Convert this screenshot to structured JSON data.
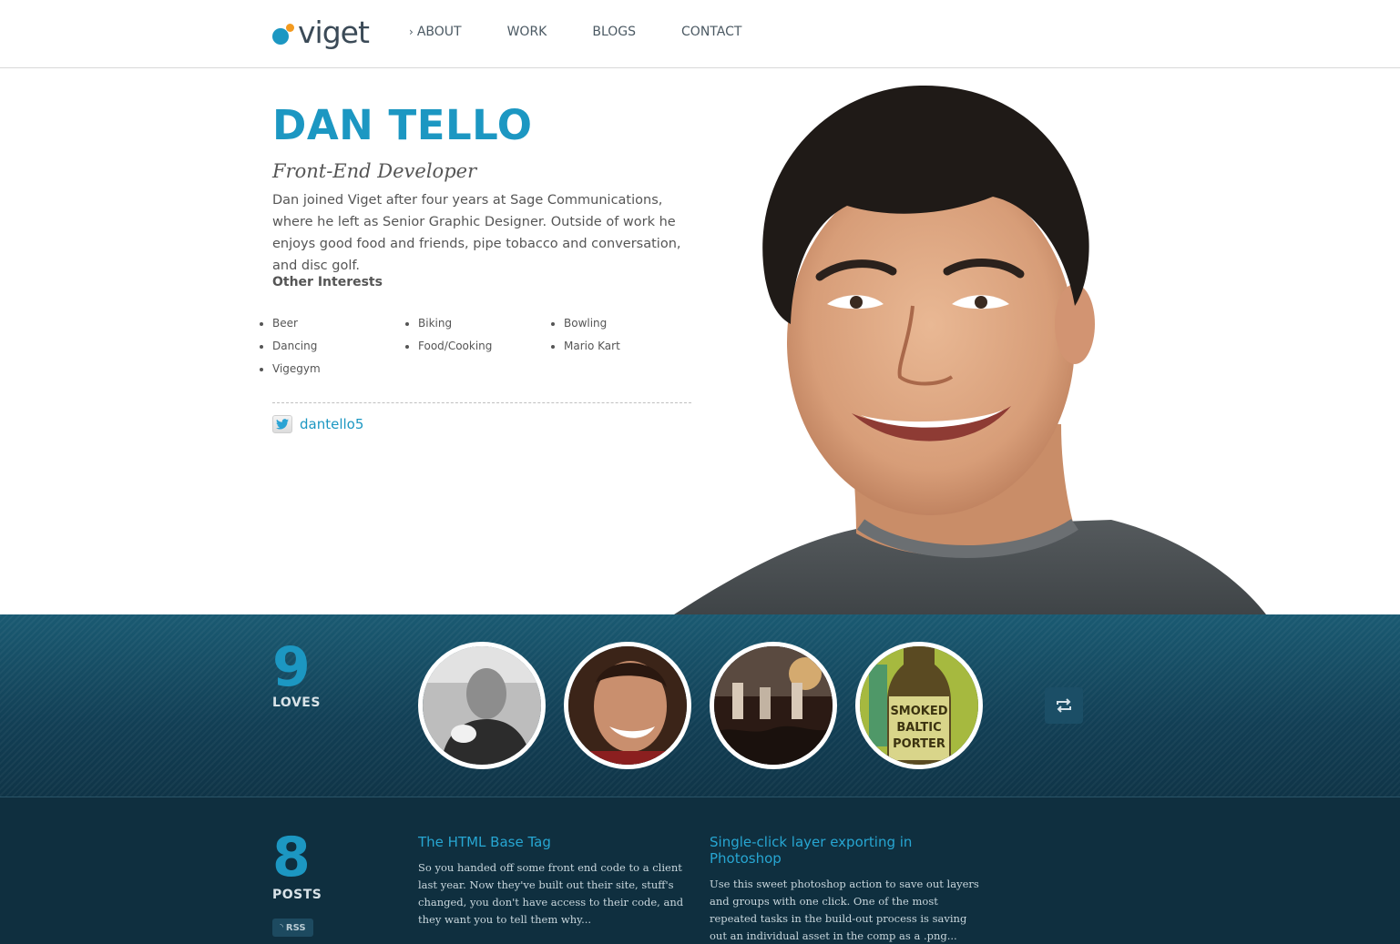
{
  "header": {
    "logo_text": "viget",
    "nav": [
      {
        "label": "ABOUT",
        "active": true
      },
      {
        "label": "WORK"
      },
      {
        "label": "BLOGS"
      },
      {
        "label": "CONTACT"
      }
    ]
  },
  "profile": {
    "name": "DAN TELLO",
    "role": "Front-End Developer",
    "bio": "Dan joined Viget after four years at Sage Communications, where he left as Senior Graphic Designer. Outside of work he enjoys good food and friends, pipe tobacco and conversation, and disc golf.",
    "interests_title": "Other Interests",
    "interests": [
      "Beer",
      "Biking",
      "Bowling",
      "Dancing",
      "Food/Cooking",
      "Mario Kart",
      "Vigegym"
    ],
    "twitter_handle": "dantello5"
  },
  "loves": {
    "count": "9",
    "label": "LOVES",
    "items": [
      {
        "icon": "man-with-pipe-photo"
      },
      {
        "icon": "smiling-woman-photo"
      },
      {
        "icon": "concert-stage-photo"
      },
      {
        "icon": "smoked-baltic-porter-bottle-photo",
        "text": "SMOKED BALTIC PORTER"
      }
    ]
  },
  "posts": {
    "count": "8",
    "label": "POSTS",
    "rss_label": "RSS",
    "items": [
      {
        "title": "The HTML Base Tag",
        "excerpt": "So you handed off some front end code to a client last year. Now they've built out their site, stuff's changed, you don't have access to their code, and they want you to tell them why..."
      },
      {
        "title": "Single-click layer exporting in Photoshop",
        "excerpt": "Use this sweet photoshop action to save out layers and groups with one click. One of the most repeated tasks in the build-out process is saving out an individual asset in the comp as a .png..."
      }
    ]
  },
  "colors": {
    "accent": "#1c97c2",
    "logo_orange": "#f39a1f",
    "band": "#123f55",
    "posts_bg": "#0f2f3f"
  }
}
